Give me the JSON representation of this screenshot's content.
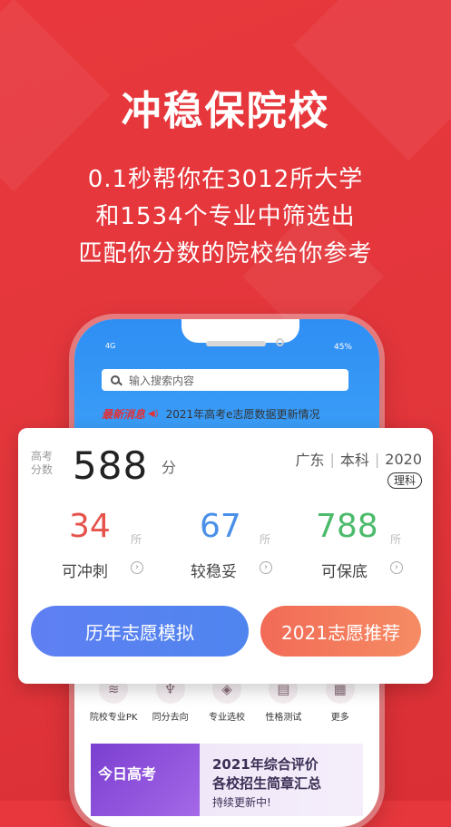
{
  "hero": {
    "title": "冲稳保院校",
    "line1": "0.1秒帮你在3012所大学",
    "line2": "和1534个专业中筛选出",
    "line3": "匹配你分数的院校给你参考"
  },
  "phone": {
    "status_battery": "45%",
    "status_signal": "4G",
    "search_placeholder": "输入搜索内容",
    "news_tag": "最新消息",
    "news_text": "2021年高考e志愿数据更新情况",
    "menu": [
      {
        "label": "院校专业PK",
        "icon": "compare-icon"
      },
      {
        "label": "同分去向",
        "icon": "microphone-icon"
      },
      {
        "label": "专业选校",
        "icon": "graduation-cap-icon"
      },
      {
        "label": "性格测试",
        "icon": "document-icon"
      },
      {
        "label": "更多",
        "icon": "grid-icon"
      }
    ],
    "banner": {
      "image_text": "今日高考",
      "line1": "2021年综合评价",
      "line2": "各校招生简章汇总",
      "line3": "持续更新中!"
    }
  },
  "card": {
    "score_label": "高考分数",
    "score": "588",
    "score_unit": "分",
    "province": "广东",
    "level": "本科",
    "year": "2020",
    "subject": "理科",
    "stats": [
      {
        "value": "34",
        "suffix": "所",
        "label": "可冲刺",
        "color": "#e5534b"
      },
      {
        "value": "67",
        "suffix": "所",
        "label": "较稳妥",
        "color": "#4a8fe8"
      },
      {
        "value": "788",
        "suffix": "所",
        "label": "可保底",
        "color": "#4cbb6c"
      }
    ],
    "btn_history": "历年志愿模拟",
    "btn_recommend": "2021志愿推荐"
  }
}
